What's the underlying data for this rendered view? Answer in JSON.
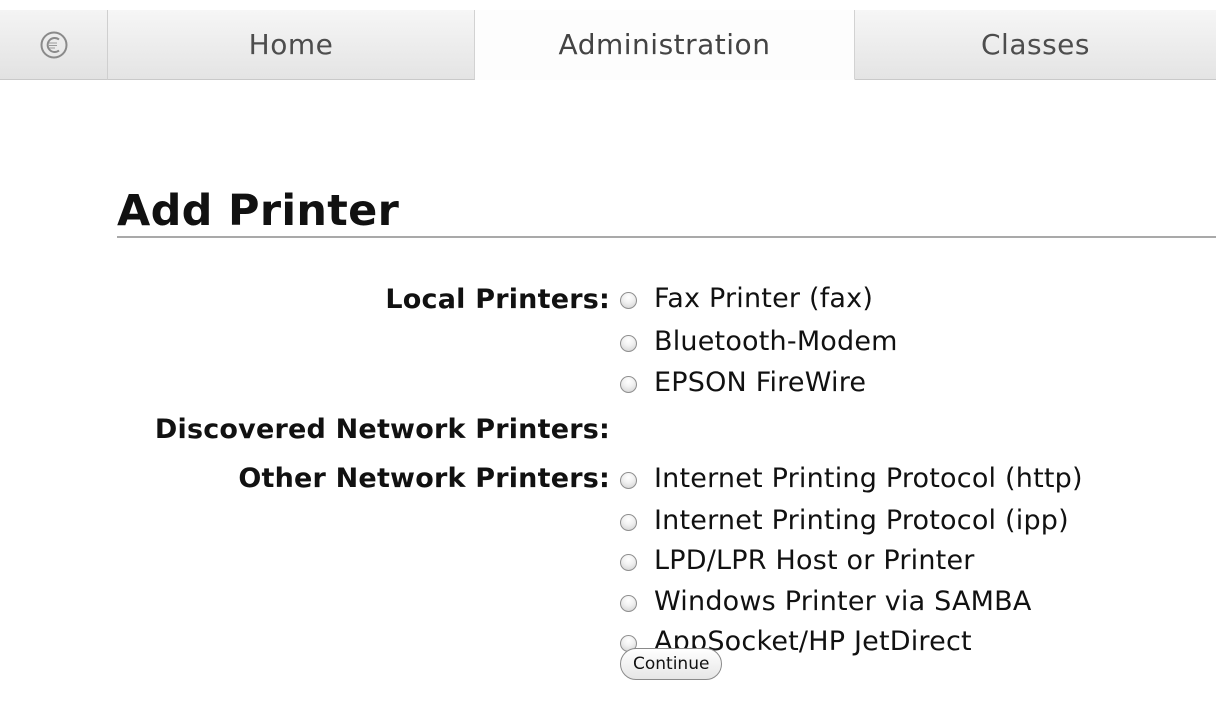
{
  "tabs": [
    {
      "label": "Home"
    },
    {
      "label": "Administration",
      "selected": true
    },
    {
      "label": "Classes"
    }
  ],
  "page": {
    "title": "Add Printer"
  },
  "sections": {
    "local": {
      "label": "Local Printers:",
      "options": [
        "Fax Printer (fax)",
        "Bluetooth-Modem",
        "EPSON FireWire"
      ]
    },
    "discovered": {
      "label": "Discovered Network Printers:"
    },
    "other": {
      "label": "Other Network Printers:",
      "options": [
        "Internet Printing Protocol (http)",
        "Internet Printing Protocol (ipp)",
        "LPD/LPR Host or Printer",
        "Windows Printer via SAMBA",
        "AppSocket/HP JetDirect"
      ]
    }
  },
  "buttons": {
    "continue": "Continue"
  },
  "icons": {
    "logo": "cups-logo-icon",
    "radio": "radio-button-icon"
  },
  "colors": {
    "tab_bg": "#e8e8e8",
    "tab_selected_bg": "#fdfdfd",
    "title_rule": "#a9a9a9"
  }
}
